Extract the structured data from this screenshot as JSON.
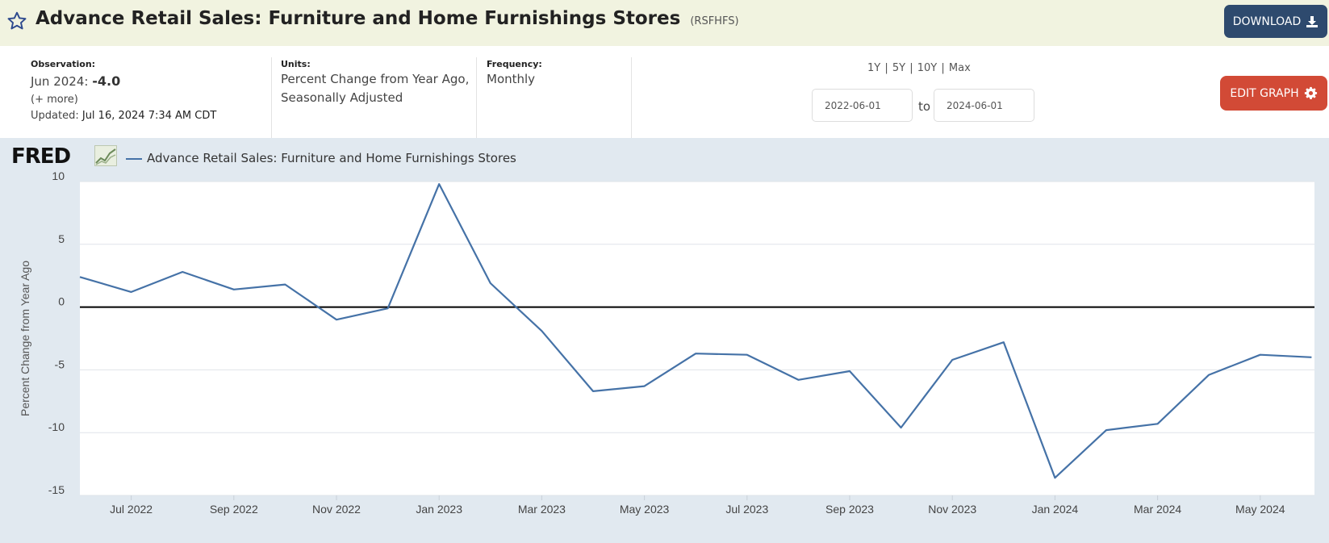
{
  "header": {
    "title": "Advance Retail Sales: Furniture and Home Furnishings Stores",
    "series_id": "(RSFHFS)",
    "download_label": "DOWNLOAD"
  },
  "meta": {
    "observation_label": "Observation:",
    "observation_date": "Jun 2024:",
    "observation_value": "-4.0",
    "more_label": "(+ more)",
    "updated_label": "Updated:",
    "updated_value": "Jul 16, 2024 7:34 AM CDT",
    "units_label": "Units:",
    "units_line1": "Percent Change from Year Ago,",
    "units_line2": "Seasonally Adjusted",
    "frequency_label": "Frequency:",
    "frequency_value": "Monthly"
  },
  "controls": {
    "ranges": [
      "1Y",
      "5Y",
      "10Y",
      "Max"
    ],
    "start_date": "2022-06-01",
    "to_label": "to",
    "end_date": "2024-06-01",
    "edit_label": "EDIT GRAPH"
  },
  "colors": {
    "series": "#4572a7",
    "header_bg": "#f1f3e0",
    "plot_bg": "#e1e9f0",
    "download_btn": "#2e4a6e",
    "edit_btn": "#d24a36"
  },
  "chart_data": {
    "type": "line",
    "brand": "FRED",
    "legend_label": "Advance Retail Sales: Furniture and Home Furnishings Stores",
    "ylabel": "Percent Change from Year Ago",
    "ylim": [
      -15,
      10
    ],
    "yticks": [
      10,
      5,
      0,
      -5,
      -10,
      -15
    ],
    "x_tick_labels": [
      "Jul 2022",
      "Sep 2022",
      "Nov 2022",
      "Jan 2023",
      "Mar 2023",
      "May 2023",
      "Jul 2023",
      "Sep 2023",
      "Nov 2023",
      "Jan 2024",
      "Mar 2024",
      "May 2024"
    ],
    "grid": true,
    "zero_line": true,
    "series": [
      {
        "name": "Advance Retail Sales: Furniture and Home Furnishings Stores",
        "x": [
          "2022-06",
          "2022-07",
          "2022-08",
          "2022-09",
          "2022-10",
          "2022-11",
          "2022-12",
          "2023-01",
          "2023-02",
          "2023-03",
          "2023-04",
          "2023-05",
          "2023-06",
          "2023-07",
          "2023-08",
          "2023-09",
          "2023-10",
          "2023-11",
          "2023-12",
          "2024-01",
          "2024-02",
          "2024-03",
          "2024-04",
          "2024-05",
          "2024-06"
        ],
        "values": [
          2.4,
          1.2,
          2.8,
          1.4,
          1.8,
          -1.0,
          -0.1,
          9.8,
          1.9,
          -1.9,
          -6.7,
          -6.3,
          -3.7,
          -3.8,
          -5.8,
          -5.1,
          -9.6,
          -4.2,
          -2.8,
          -13.6,
          -9.8,
          -9.3,
          -5.4,
          -3.8,
          -4.0
        ]
      }
    ]
  }
}
